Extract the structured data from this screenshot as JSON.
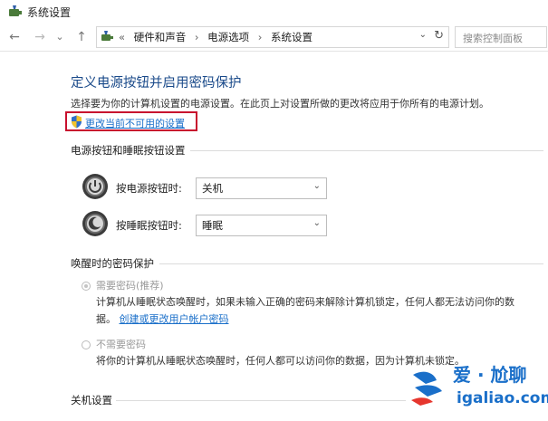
{
  "window": {
    "title": "系统设置",
    "app_icon": "power-options-icon"
  },
  "nav": {
    "back_glyph": "←",
    "forward_glyph": "→",
    "recent_glyph": "⌄",
    "up_glyph": "↑"
  },
  "address": {
    "overflow": "«",
    "crumbs": [
      "硬件和声音",
      "电源选项",
      "系统设置"
    ],
    "separator": "›",
    "dropdown_glyph": "⌄",
    "refresh_glyph": "↻"
  },
  "search": {
    "placeholder": "搜索控制面板"
  },
  "main": {
    "title": "定义电源按钮并启用密码保护",
    "description": "选择要为你的计算机设置的电源设置。在此页上对设置所做的更改将应用于你所有的电源计划。",
    "change_settings_link": "更改当前不可用的设置",
    "power_section": {
      "heading": "电源按钮和睡眠按钮设置",
      "power_button": {
        "label": "按电源按钮时:",
        "value": "关机",
        "icon": "power-button-icon"
      },
      "sleep_button": {
        "label": "按睡眠按钮时:",
        "value": "睡眠",
        "icon": "sleep-button-icon"
      },
      "select_arrow": "⌄"
    },
    "wake_section": {
      "heading": "唤醒时的密码保护",
      "require_password": {
        "label": "需要密码(推荐)",
        "selected": true,
        "desc_line1": "计算机从睡眠状态唤醒时，如果未输入正确的密码来解除计算机锁定，任何人都无法访问你的数",
        "desc_line2_prefix": "据。",
        "desc_link": "创建或更改用户帐户密码"
      },
      "no_password": {
        "label": "不需要密码",
        "selected": false,
        "desc": "将你的计算机从睡眠状态唤醒时，任何人都可以访问你的数据，因为计算机未锁定。"
      }
    },
    "shutdown_section": {
      "heading": "关机设置"
    }
  },
  "watermark": {
    "text": "爱 · 尬聊",
    "url": "igaliao.com"
  },
  "colors": {
    "title_blue": "#1a4a8a",
    "link_blue": "#1a6fc9",
    "highlight_red": "#c8102e"
  }
}
